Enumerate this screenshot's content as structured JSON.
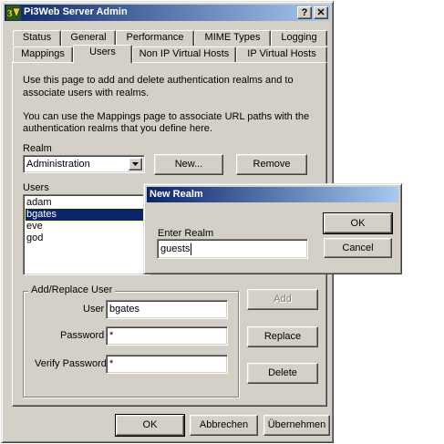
{
  "window": {
    "title": "Pi3Web Server Admin",
    "help_glyph": "?",
    "close_glyph": "✕"
  },
  "tabs_row1": [
    "Status",
    "General",
    "Performance",
    "MIME Types",
    "Logging"
  ],
  "tabs_row2": [
    "Mappings",
    "Users",
    "Non IP Virtual Hosts",
    "IP Virtual Hosts"
  ],
  "active_tab": "Users",
  "description": {
    "line1": "Use this page to add and delete authentication realms and to",
    "line2": "associate users with realms.",
    "line3": "You can use the Mappings page to associate URL paths with the",
    "line4": "authentication realms that you define here."
  },
  "realm": {
    "label": "Realm",
    "selected": "Administration",
    "new_button": "New...",
    "remove_button": "Remove"
  },
  "users": {
    "label": "Users",
    "items": [
      "adam",
      "bgates",
      "eve",
      "god"
    ],
    "selected_index": 1
  },
  "add_replace": {
    "group_label": "Add/Replace User",
    "user_label": "User",
    "user_value": "bgates",
    "password_label": "Password",
    "password_value": "*",
    "verify_label": "Verify Password",
    "verify_value": "*",
    "add_button": "Add",
    "replace_button": "Replace",
    "delete_button": "Delete"
  },
  "footer": {
    "ok": "OK",
    "cancel": "Abbrechen",
    "apply": "Übernehmen"
  },
  "new_realm_dialog": {
    "title": "New Realm",
    "prompt": "Enter Realm",
    "value": "guests",
    "ok": "OK",
    "cancel": "Cancel"
  },
  "colors": {
    "titlebar_start": "#0a246a",
    "titlebar_end": "#a6caf0",
    "face": "#d4d0c8",
    "selection": "#0a246a"
  }
}
